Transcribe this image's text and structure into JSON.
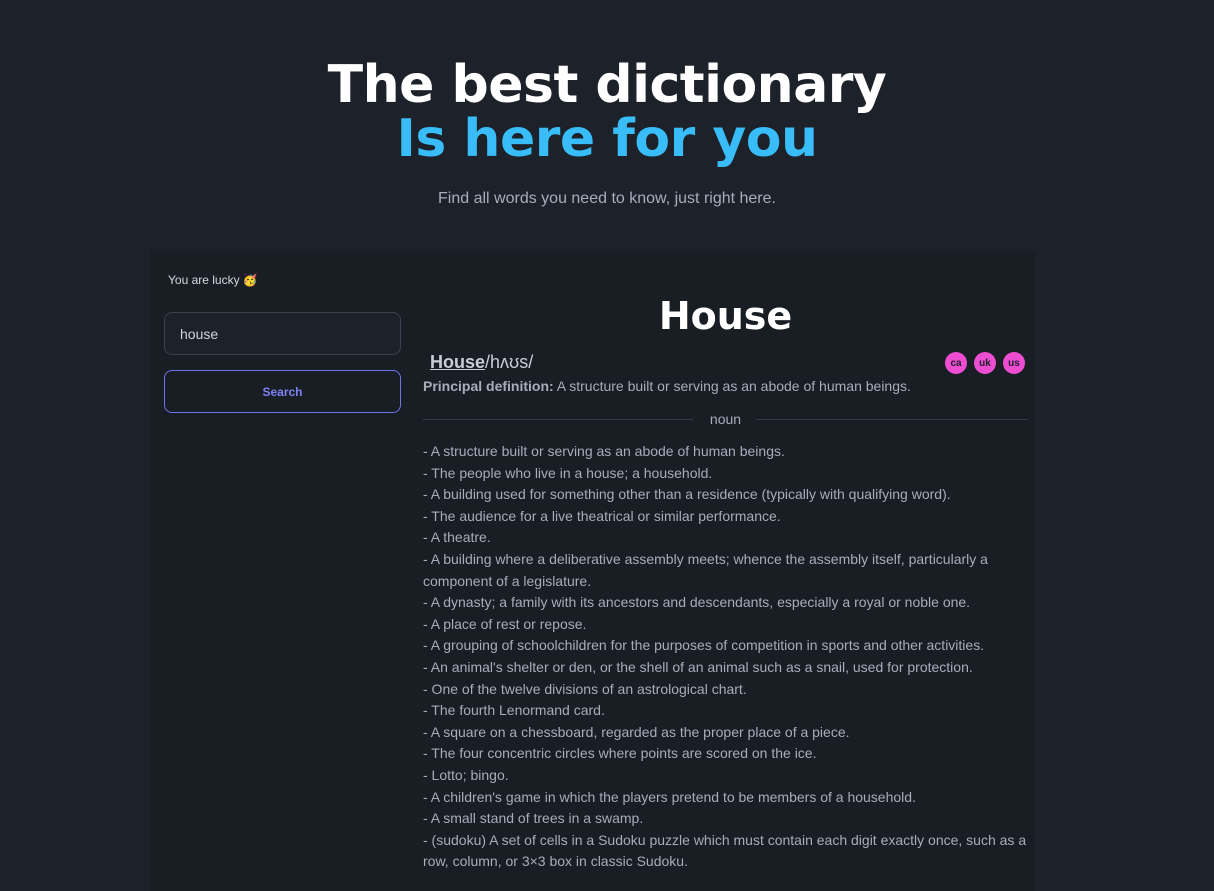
{
  "hero": {
    "title_line1": "The best dictionary",
    "title_line2": "Is here for you",
    "subtitle": "Find all words you need to know, just right here."
  },
  "sidebar": {
    "lucky_text": "You are lucky 🥳",
    "search_value": "house",
    "search_button": "Search"
  },
  "result": {
    "title": "House",
    "word": "House",
    "phonetic": "/hʌʊs/",
    "accents": [
      "ca",
      "uk",
      "us"
    ],
    "principal_label": "Principal definition:",
    "principal_text": " A structure built or serving as an abode of human beings.",
    "part_of_speech": "noun",
    "definitions": [
      "- A structure built or serving as an abode of human beings.",
      "- The people who live in a house; a household.",
      "- A building used for something other than a residence (typically with qualifying word).",
      "- The audience for a live theatrical or similar performance.",
      "- A theatre.",
      "- A building where a deliberative assembly meets; whence the assembly itself, particularly a component of a legislature.",
      "- A dynasty; a family with its ancestors and descendants, especially a royal or noble one.",
      "- A place of rest or repose.",
      "- A grouping of schoolchildren for the purposes of competition in sports and other activities.",
      "- An animal's shelter or den, or the shell of an animal such as a snail, used for protection.",
      "- One of the twelve divisions of an astrological chart.",
      "- The fourth Lenormand card.",
      "- A square on a chessboard, regarded as the proper place of a piece.",
      "- The four concentric circles where points are scored on the ice.",
      "- Lotto; bingo.",
      "- A children's game in which the players pretend to be members of a household.",
      "- A small stand of trees in a swamp.",
      "- (sudoku) A set of cells in a Sudoku puzzle which must contain each digit exactly once, such as a row, column, or 3×3 box in classic Sudoku."
    ]
  },
  "colors": {
    "background": "#1d212a",
    "card": "#191d24",
    "accent_blue": "#38bdf8",
    "search_border": "#6d74e8",
    "badge": "#ec4dd1"
  }
}
